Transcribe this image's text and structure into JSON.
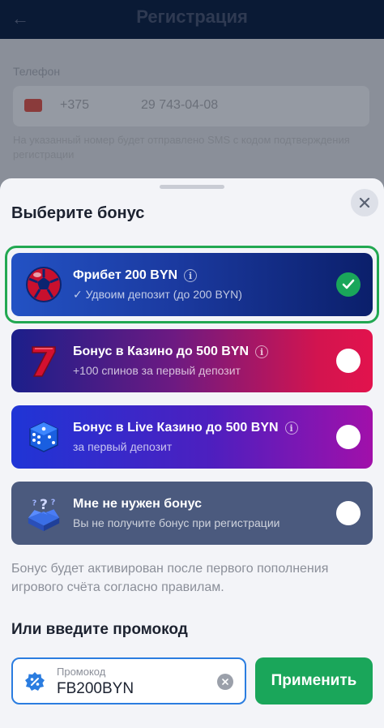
{
  "background": {
    "header_title": "Регистрация",
    "field_label": "Телефон",
    "phone_code": "+375",
    "phone_number": "29 743-04-08",
    "hint": "На указанный номер будет отправлено SMS с кодом подтверждения регистрации"
  },
  "sheet": {
    "title": "Выберите бонус",
    "options": [
      {
        "title": "Фрибет 200 BYN",
        "subtitle": "✓ Удвоим депозит (до 200 BYN)",
        "icon": "soccer-ball-icon",
        "selected": true
      },
      {
        "title": "Бонус в Казино до 500 BYN",
        "subtitle": "+100 спинов за первый депозит",
        "icon": "slot-seven-icon",
        "selected": false
      },
      {
        "title": "Бонус в Live Казино до 500 BYN",
        "subtitle": "за первый депозит",
        "icon": "dice-icon",
        "selected": false
      },
      {
        "title": "Мне не нужен бонус",
        "subtitle": "Вы не получите бонус при регистрации",
        "icon": "mystery-box-icon",
        "selected": false
      }
    ],
    "note": "Бонус будет активирован после первого пополнения игрового счёта согласно правилам.",
    "promo": {
      "title": "Или введите промокод",
      "label": "Промокод",
      "value": "FB200BYN",
      "apply_label": "Применить"
    }
  },
  "colors": {
    "accent_green": "#1aa65a",
    "focus_blue": "#2b7de0",
    "sheet_bg": "#f3f4f8"
  }
}
